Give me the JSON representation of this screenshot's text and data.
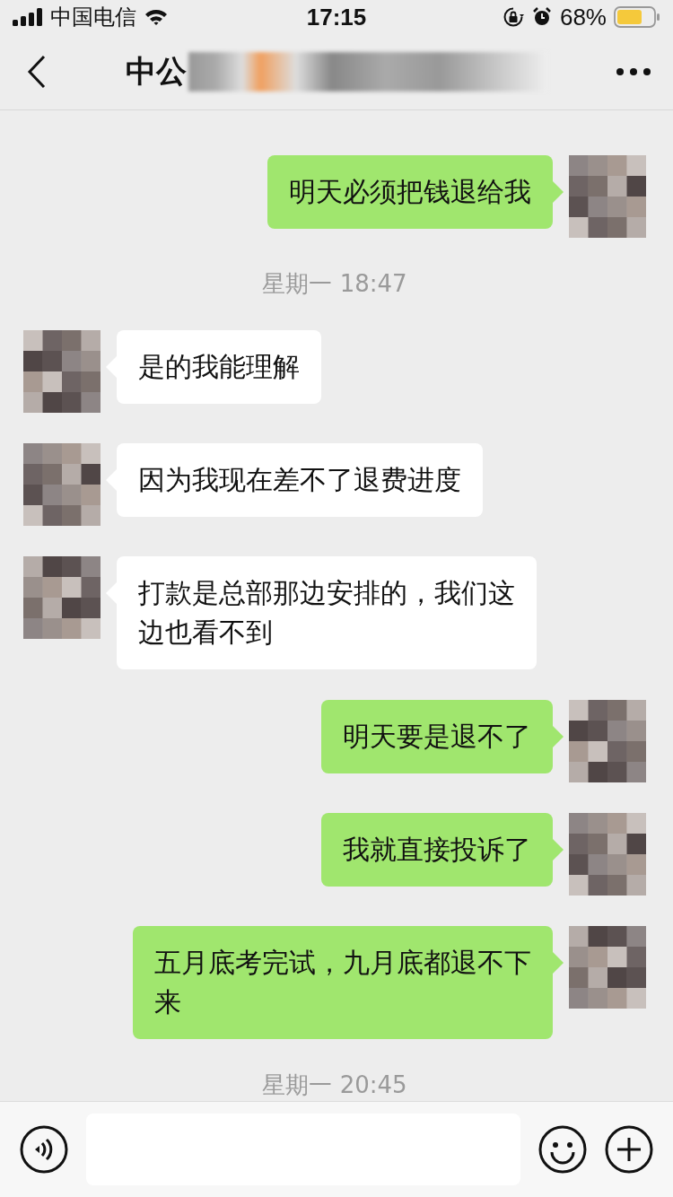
{
  "status_bar": {
    "carrier": "中国电信",
    "time": "17:15",
    "battery": "68%"
  },
  "header": {
    "title": "中公"
  },
  "messages": [
    {
      "kind": "sent",
      "text": "明天必须把钱退给我"
    },
    {
      "kind": "time",
      "text": "星期一 18:47"
    },
    {
      "kind": "received",
      "text": "是的我能理解"
    },
    {
      "kind": "received",
      "text": "因为我现在差不了退费进度"
    },
    {
      "kind": "received",
      "text": "打款是总部那边安排的，我们这边也看不到"
    },
    {
      "kind": "sent",
      "text": "明天要是退不了"
    },
    {
      "kind": "sent",
      "text": "我就直接投诉了"
    },
    {
      "kind": "sent",
      "text": "五月底考完试，九月底都退不下来"
    },
    {
      "kind": "time",
      "text": "星期一 20:45"
    }
  ]
}
